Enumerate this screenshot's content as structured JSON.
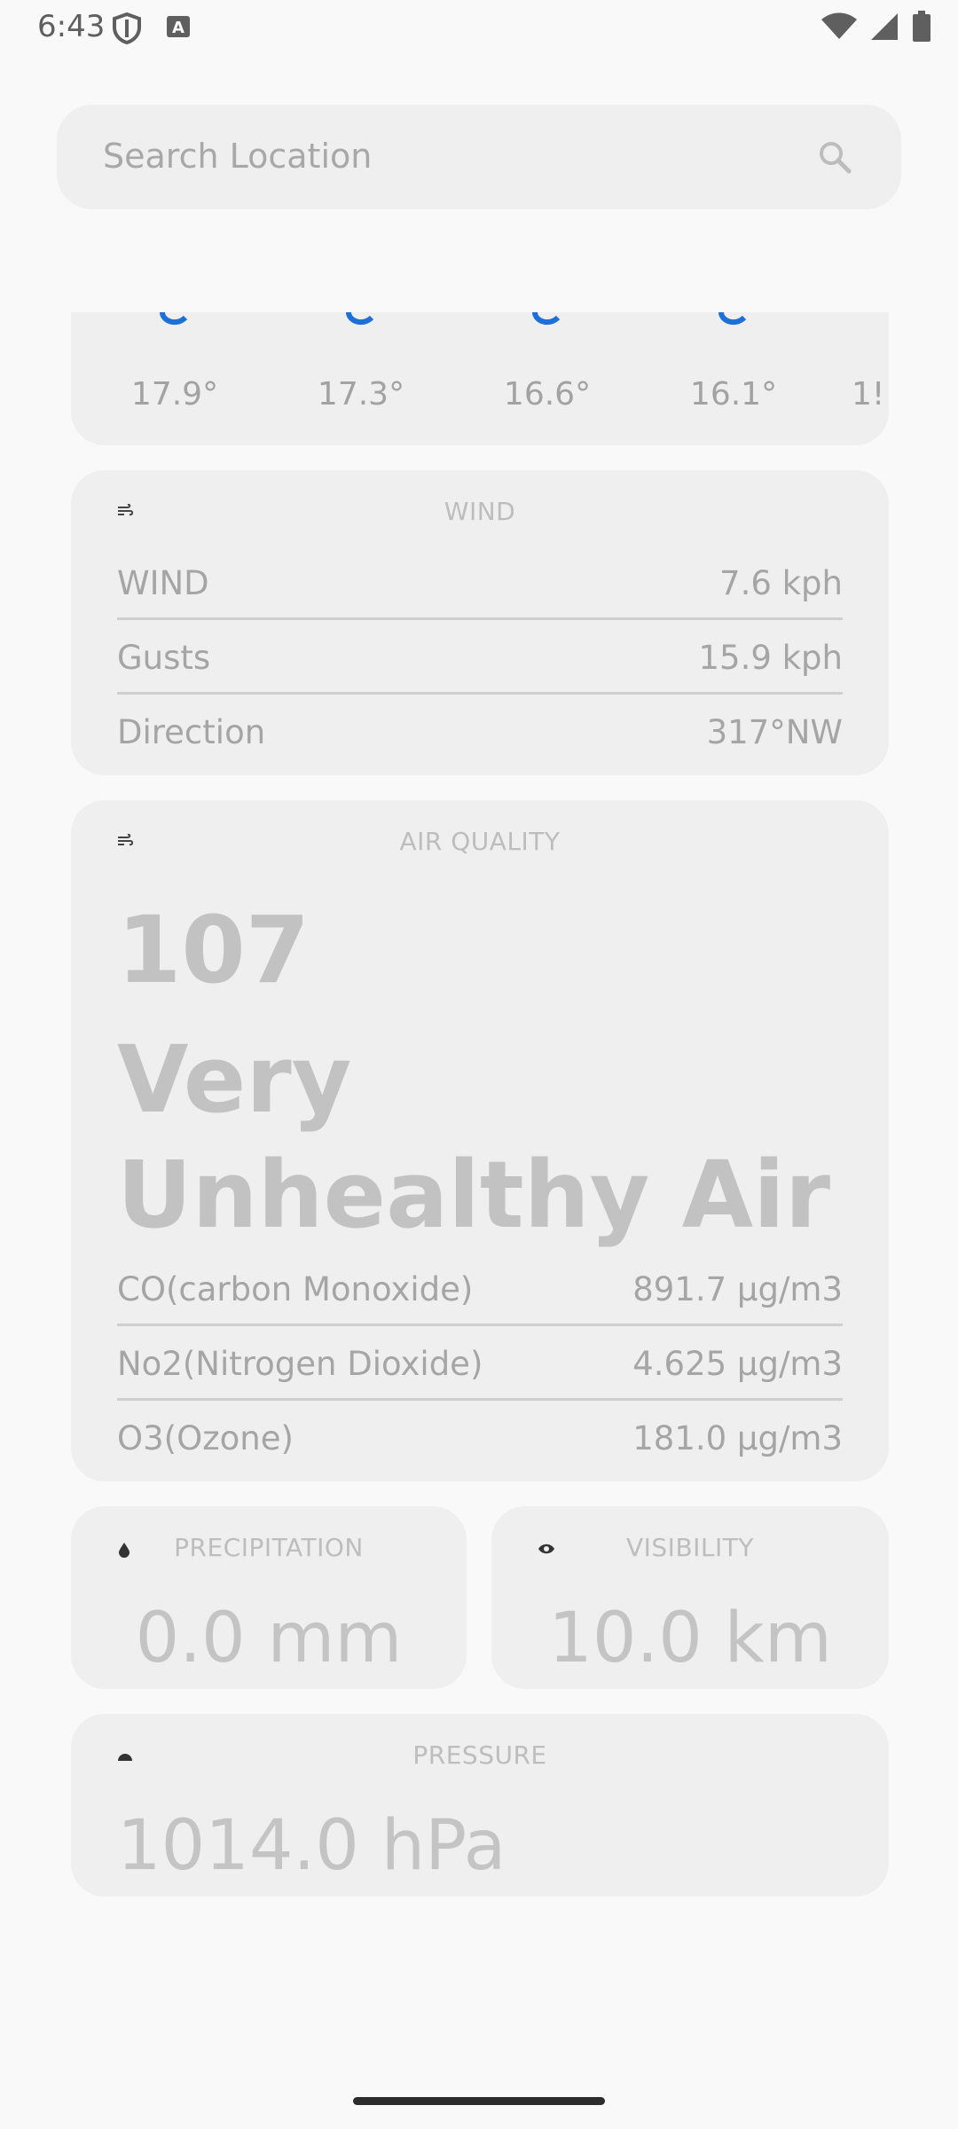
{
  "status_bar": {
    "time": "6:43"
  },
  "search": {
    "placeholder": "Search Location"
  },
  "hourly": {
    "temps": [
      "17.9°",
      "17.3°",
      "16.6°",
      "16.1°",
      "1!"
    ]
  },
  "wind": {
    "title": "WIND",
    "rows": [
      {
        "label": "WIND",
        "value": "7.6 kph"
      },
      {
        "label": "Gusts",
        "value": "15.9 kph"
      },
      {
        "label": "Direction",
        "value": "317°NW"
      }
    ]
  },
  "air_quality": {
    "title": "AIR QUALITY",
    "index": "107",
    "description": "Very Unhealthy Air",
    "rows": [
      {
        "label": "CO(carbon Monoxide)",
        "value": "891.7 μg/m3"
      },
      {
        "label": "No2(Nitrogen Dioxide)",
        "value": "4.625 μg/m3"
      },
      {
        "label": "O3(Ozone)",
        "value": "181.0 μg/m3"
      }
    ]
  },
  "precipitation": {
    "title": "PRECIPITATION",
    "value": "0.0 mm"
  },
  "visibility": {
    "title": "VISIBILITY",
    "value": "10.0 km"
  },
  "pressure": {
    "title": "PRESSURE",
    "value": "1014.0 hPa"
  },
  "colors": {
    "background": "#f9f9f9",
    "card": "#efefef",
    "accent_icon": "#1e6fd9"
  }
}
